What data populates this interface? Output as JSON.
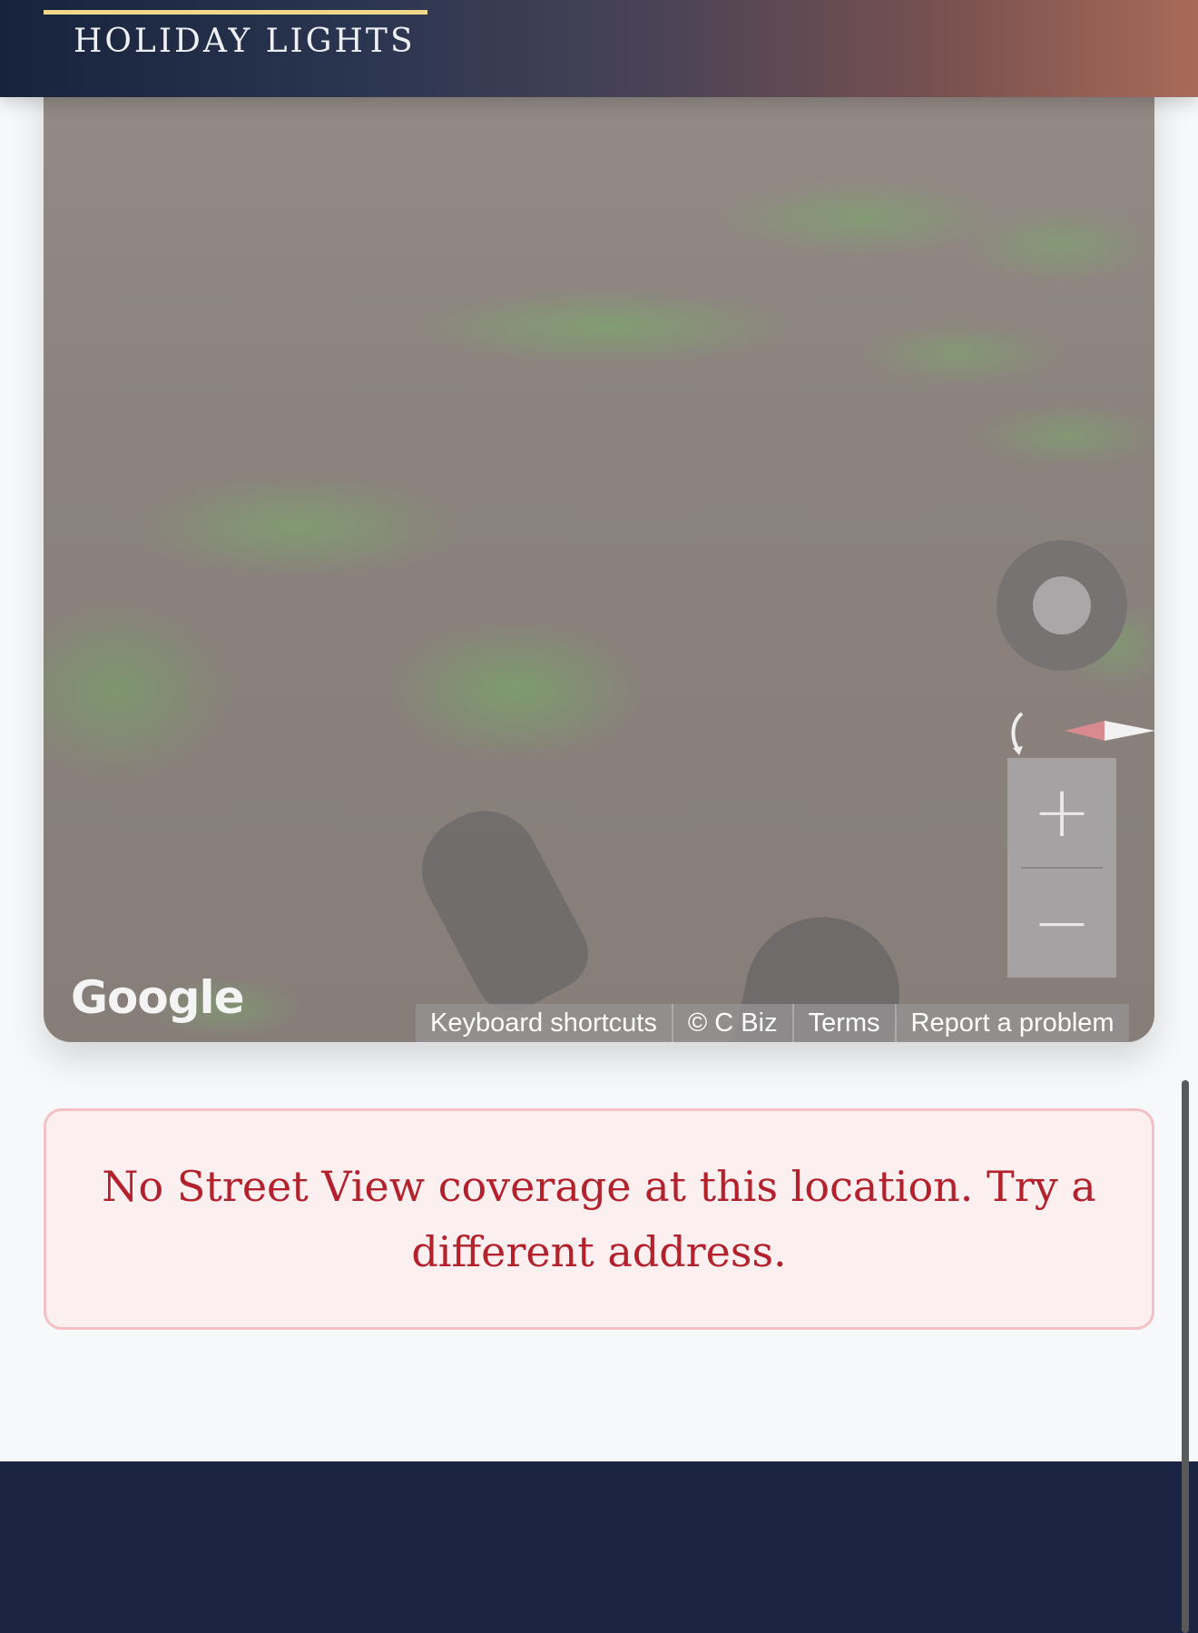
{
  "header": {
    "title": "HOLIDAY LIGHTS",
    "accent_color": "#f1d789"
  },
  "street_view": {
    "icons": {
      "pegman": "pegman-icon",
      "rotate": "rotate-icon",
      "compass": "compass-icon",
      "zoom_in": "plus-icon",
      "zoom_out": "minus-icon"
    },
    "zoom_in_label": "+",
    "zoom_out_label": "−",
    "logo_text": "Google",
    "attribution": {
      "keyboard_shortcuts": "Keyboard shortcuts",
      "copyright": "© C Biz",
      "terms": "Terms",
      "report": "Report a problem"
    }
  },
  "alert": {
    "message": "No Street View coverage at this location. Try a different address.",
    "text_color": "#b3222c",
    "background_color": "#fbeff0"
  },
  "footer": {
    "background_color": "#1b2543"
  }
}
